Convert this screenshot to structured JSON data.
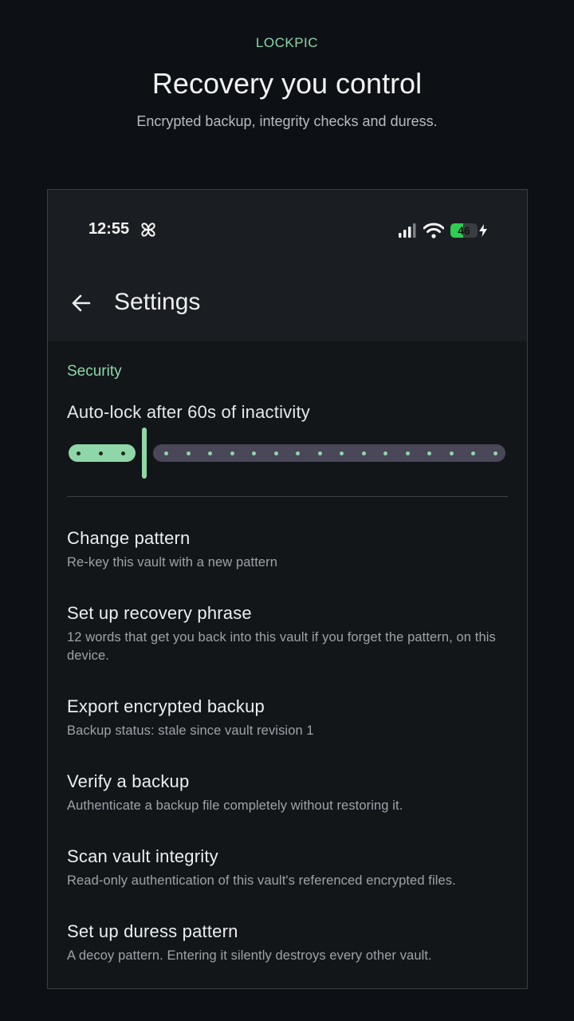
{
  "promo": {
    "brand": "LOCKPIC",
    "headline": "Recovery you control",
    "subline": "Encrypted backup, integrity checks and duress."
  },
  "status_bar": {
    "time": "12:55",
    "battery": "46",
    "icons": [
      "pinwheel-icon",
      "signal-icon",
      "wifi-icon",
      "battery-icon",
      "charging-icon"
    ]
  },
  "app_bar": {
    "title": "Settings",
    "back_icon": "back-arrow-icon"
  },
  "security": {
    "section_label": "Security",
    "auto_lock_label": "Auto-lock after 60s of inactivity",
    "auto_lock_seconds": 60
  },
  "items": [
    {
      "title": "Change pattern",
      "subtitle": "Re-key this vault with a new pattern"
    },
    {
      "title": "Set up recovery phrase",
      "subtitle": "12 words that get you back into this vault if you forget the pattern, on this device."
    },
    {
      "title": "Export encrypted backup",
      "subtitle": "Backup status: stale since vault revision 1"
    },
    {
      "title": "Verify a backup",
      "subtitle": "Authenticate a backup file completely without restoring it."
    },
    {
      "title": "Scan vault integrity",
      "subtitle": "Read-only authentication of this vault's referenced encrypted files."
    },
    {
      "title": "Set up duress pattern",
      "subtitle": "A decoy pattern. Entering it silently destroys every other vault."
    }
  ],
  "colors": {
    "accent": "#8fd6a8",
    "background": "#0d1116",
    "surface": "#121619",
    "app_bar": "#1a1d21",
    "slider_inactive": "#4a4758",
    "battery": "#2ecc52"
  }
}
